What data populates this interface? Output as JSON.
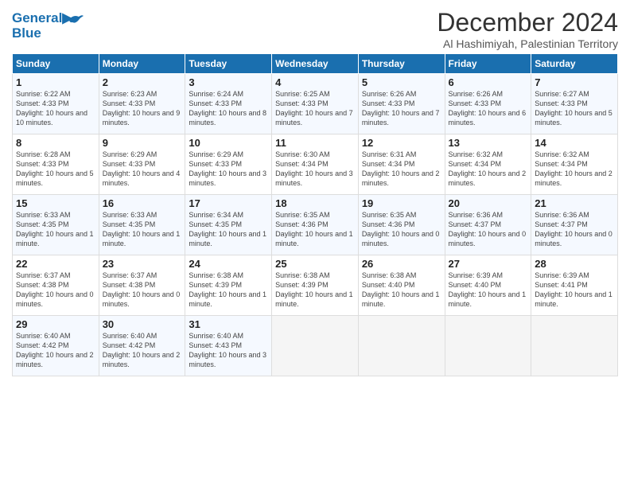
{
  "logo": {
    "line1": "General",
    "line2": "Blue"
  },
  "title": "December 2024",
  "subtitle": "Al Hashimiyah, Palestinian Territory",
  "days_of_week": [
    "Sunday",
    "Monday",
    "Tuesday",
    "Wednesday",
    "Thursday",
    "Friday",
    "Saturday"
  ],
  "weeks": [
    [
      {
        "day": "1",
        "sunrise": "6:22 AM",
        "sunset": "4:33 PM",
        "daylight": "10 hours and 10 minutes."
      },
      {
        "day": "2",
        "sunrise": "6:23 AM",
        "sunset": "4:33 PM",
        "daylight": "10 hours and 9 minutes."
      },
      {
        "day": "3",
        "sunrise": "6:24 AM",
        "sunset": "4:33 PM",
        "daylight": "10 hours and 8 minutes."
      },
      {
        "day": "4",
        "sunrise": "6:25 AM",
        "sunset": "4:33 PM",
        "daylight": "10 hours and 7 minutes."
      },
      {
        "day": "5",
        "sunrise": "6:26 AM",
        "sunset": "4:33 PM",
        "daylight": "10 hours and 7 minutes."
      },
      {
        "day": "6",
        "sunrise": "6:26 AM",
        "sunset": "4:33 PM",
        "daylight": "10 hours and 6 minutes."
      },
      {
        "day": "7",
        "sunrise": "6:27 AM",
        "sunset": "4:33 PM",
        "daylight": "10 hours and 5 minutes."
      }
    ],
    [
      {
        "day": "8",
        "sunrise": "6:28 AM",
        "sunset": "4:33 PM",
        "daylight": "10 hours and 5 minutes."
      },
      {
        "day": "9",
        "sunrise": "6:29 AM",
        "sunset": "4:33 PM",
        "daylight": "10 hours and 4 minutes."
      },
      {
        "day": "10",
        "sunrise": "6:29 AM",
        "sunset": "4:33 PM",
        "daylight": "10 hours and 3 minutes."
      },
      {
        "day": "11",
        "sunrise": "6:30 AM",
        "sunset": "4:34 PM",
        "daylight": "10 hours and 3 minutes."
      },
      {
        "day": "12",
        "sunrise": "6:31 AM",
        "sunset": "4:34 PM",
        "daylight": "10 hours and 2 minutes."
      },
      {
        "day": "13",
        "sunrise": "6:32 AM",
        "sunset": "4:34 PM",
        "daylight": "10 hours and 2 minutes."
      },
      {
        "day": "14",
        "sunrise": "6:32 AM",
        "sunset": "4:34 PM",
        "daylight": "10 hours and 2 minutes."
      }
    ],
    [
      {
        "day": "15",
        "sunrise": "6:33 AM",
        "sunset": "4:35 PM",
        "daylight": "10 hours and 1 minute."
      },
      {
        "day": "16",
        "sunrise": "6:33 AM",
        "sunset": "4:35 PM",
        "daylight": "10 hours and 1 minute."
      },
      {
        "day": "17",
        "sunrise": "6:34 AM",
        "sunset": "4:35 PM",
        "daylight": "10 hours and 1 minute."
      },
      {
        "day": "18",
        "sunrise": "6:35 AM",
        "sunset": "4:36 PM",
        "daylight": "10 hours and 1 minute."
      },
      {
        "day": "19",
        "sunrise": "6:35 AM",
        "sunset": "4:36 PM",
        "daylight": "10 hours and 0 minutes."
      },
      {
        "day": "20",
        "sunrise": "6:36 AM",
        "sunset": "4:37 PM",
        "daylight": "10 hours and 0 minutes."
      },
      {
        "day": "21",
        "sunrise": "6:36 AM",
        "sunset": "4:37 PM",
        "daylight": "10 hours and 0 minutes."
      }
    ],
    [
      {
        "day": "22",
        "sunrise": "6:37 AM",
        "sunset": "4:38 PM",
        "daylight": "10 hours and 0 minutes."
      },
      {
        "day": "23",
        "sunrise": "6:37 AM",
        "sunset": "4:38 PM",
        "daylight": "10 hours and 0 minutes."
      },
      {
        "day": "24",
        "sunrise": "6:38 AM",
        "sunset": "4:39 PM",
        "daylight": "10 hours and 1 minute."
      },
      {
        "day": "25",
        "sunrise": "6:38 AM",
        "sunset": "4:39 PM",
        "daylight": "10 hours and 1 minute."
      },
      {
        "day": "26",
        "sunrise": "6:38 AM",
        "sunset": "4:40 PM",
        "daylight": "10 hours and 1 minute."
      },
      {
        "day": "27",
        "sunrise": "6:39 AM",
        "sunset": "4:40 PM",
        "daylight": "10 hours and 1 minute."
      },
      {
        "day": "28",
        "sunrise": "6:39 AM",
        "sunset": "4:41 PM",
        "daylight": "10 hours and 1 minute."
      }
    ],
    [
      {
        "day": "29",
        "sunrise": "6:40 AM",
        "sunset": "4:42 PM",
        "daylight": "10 hours and 2 minutes."
      },
      {
        "day": "30",
        "sunrise": "6:40 AM",
        "sunset": "4:42 PM",
        "daylight": "10 hours and 2 minutes."
      },
      {
        "day": "31",
        "sunrise": "6:40 AM",
        "sunset": "4:43 PM",
        "daylight": "10 hours and 3 minutes."
      },
      null,
      null,
      null,
      null
    ]
  ],
  "cell_labels": {
    "sunrise": "Sunrise:",
    "sunset": "Sunset:",
    "daylight": "Daylight:"
  }
}
